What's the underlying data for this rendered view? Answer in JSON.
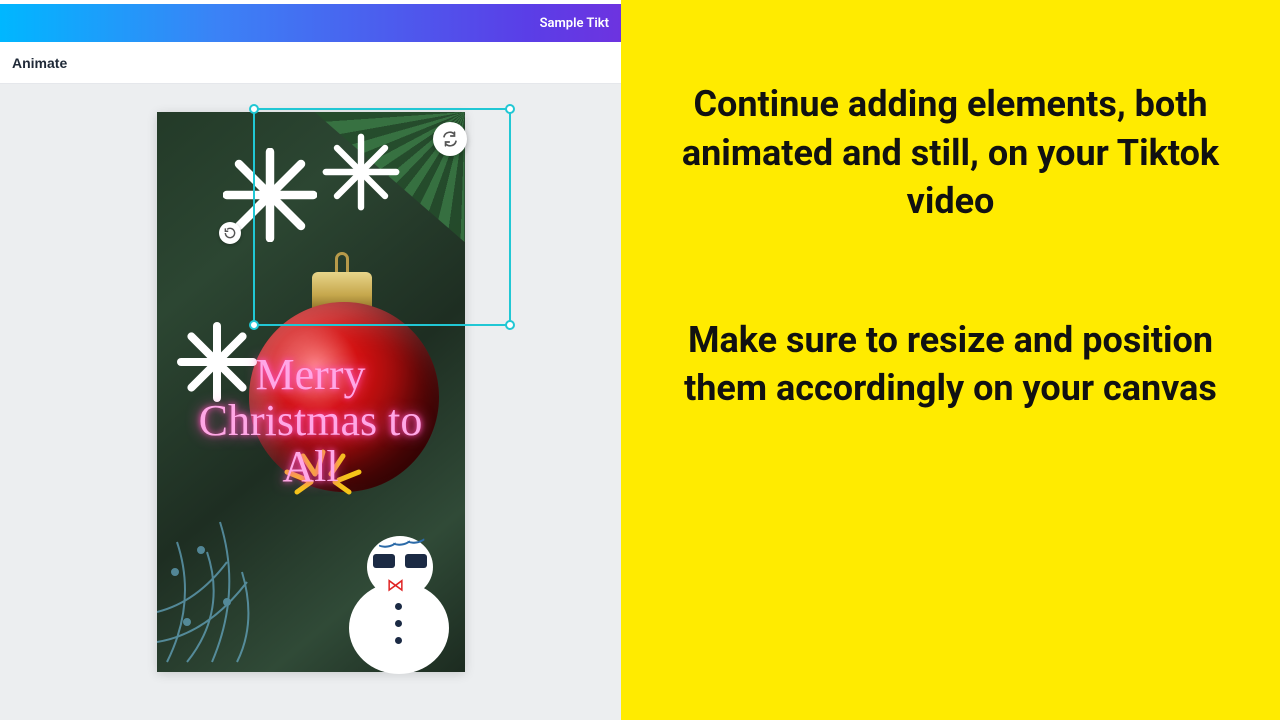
{
  "header": {
    "title": "Sample Tikt"
  },
  "toolbar": {
    "animate_label": "Animate"
  },
  "canvas": {
    "text_line1": "Merry",
    "text_line2": "Christmas to",
    "text_line3": "All"
  },
  "icons": {
    "rotate": "rotate-icon",
    "replace": "replace-icon"
  },
  "instructions": {
    "p1": "Continue adding elements, both animated and still, on your Tiktok video",
    "p2": "Make sure to resize and position them accordingly on your canvas"
  }
}
